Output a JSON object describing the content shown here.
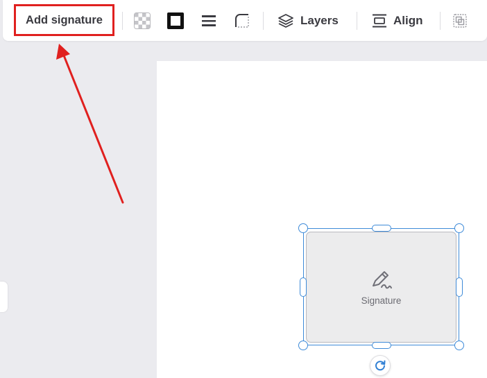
{
  "toolbar": {
    "add_signature_label": "Add signature",
    "layers_label": "Layers",
    "align_label": "Align",
    "icons": [
      "transparency-icon",
      "border-color-icon",
      "line-weight-icon",
      "corner-radius-icon",
      "layers-icon",
      "align-icon",
      "group-icon"
    ]
  },
  "signature_field": {
    "label": "Signature",
    "icon": "pen-icon"
  },
  "colors": {
    "highlight_box": "#e0201f",
    "annotation_arrow": "#e0201f",
    "selection": "#3d8ad8",
    "canvas_background": "#ebebef"
  }
}
